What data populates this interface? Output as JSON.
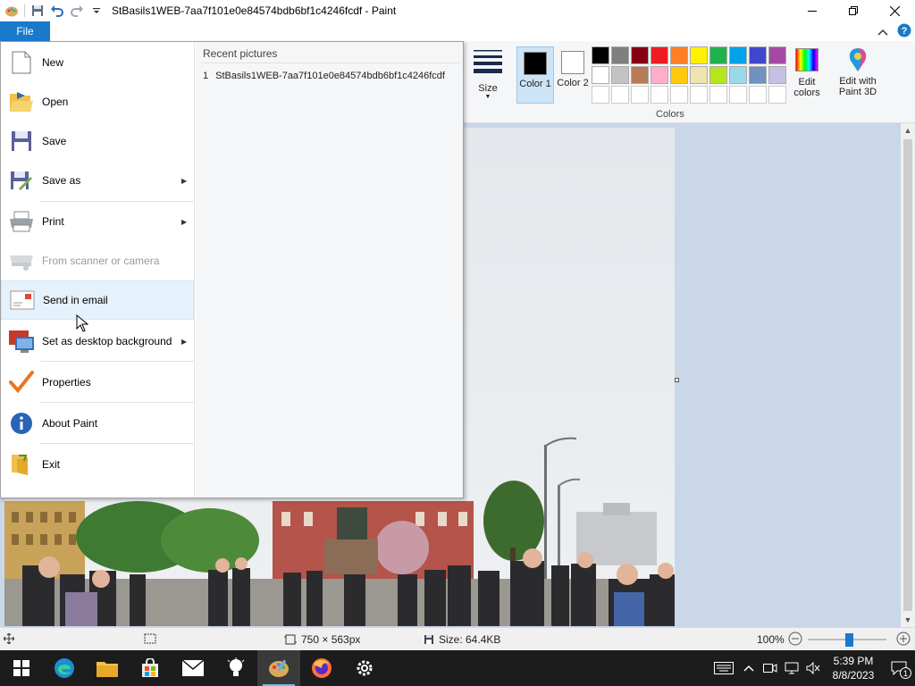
{
  "window": {
    "title": "StBasils1WEB-7aa7f101e0e84574bdb6bf1c4246fcdf - Paint"
  },
  "ribbon": {
    "file_tab": "File",
    "size_label": "Size",
    "color1_label": "Color 1",
    "color2_label": "Color 2",
    "colors_group_label": "Colors",
    "edit_colors_label": "Edit colors",
    "edit_paint3d_label": "Edit with Paint 3D",
    "color1_value": "#000000",
    "color2_value": "#ffffff",
    "palette": [
      "#000000",
      "#7f7f7f",
      "#880015",
      "#ed1c24",
      "#ff7f27",
      "#fff200",
      "#22b14c",
      "#00a2e8",
      "#3f48cc",
      "#a349a4",
      "#ffffff",
      "#c3c3c3",
      "#b97a57",
      "#ffaec9",
      "#ffc90e",
      "#efe4b0",
      "#b5e61d",
      "#99d9ea",
      "#7092be",
      "#c8bfe7",
      "#ffffff",
      "#ffffff",
      "#ffffff",
      "#ffffff",
      "#ffffff",
      "#ffffff",
      "#ffffff",
      "#ffffff",
      "#ffffff",
      "#ffffff"
    ]
  },
  "file_menu": {
    "items": [
      {
        "label": "New",
        "icon": "new-file-icon"
      },
      {
        "label": "Open",
        "icon": "open-folder-icon"
      },
      {
        "label": "Save",
        "icon": "save-disk-icon"
      },
      {
        "label": "Save as",
        "icon": "save-as-icon"
      },
      {
        "label": "Print",
        "icon": "printer-icon"
      },
      {
        "label": "From scanner or camera",
        "icon": "scanner-icon"
      },
      {
        "label": "Send in email",
        "icon": "email-icon"
      },
      {
        "label": "Set as desktop background",
        "icon": "desktop-background-icon"
      },
      {
        "label": "Properties",
        "icon": "checkmark-icon"
      },
      {
        "label": "About Paint",
        "icon": "info-icon"
      },
      {
        "label": "Exit",
        "icon": "exit-icon"
      }
    ],
    "recent_title": "Recent pictures",
    "recent": [
      {
        "index": "1",
        "name": "StBasils1WEB-7aa7f101e0e84574bdb6bf1c4246fcdf"
      }
    ]
  },
  "statusbar": {
    "dimensions": "750 × 563px",
    "size": "Size: 64.4KB",
    "zoom": "100%"
  },
  "taskbar": {
    "time": "5:39 PM",
    "date": "8/8/2023",
    "notification_count": "1"
  }
}
